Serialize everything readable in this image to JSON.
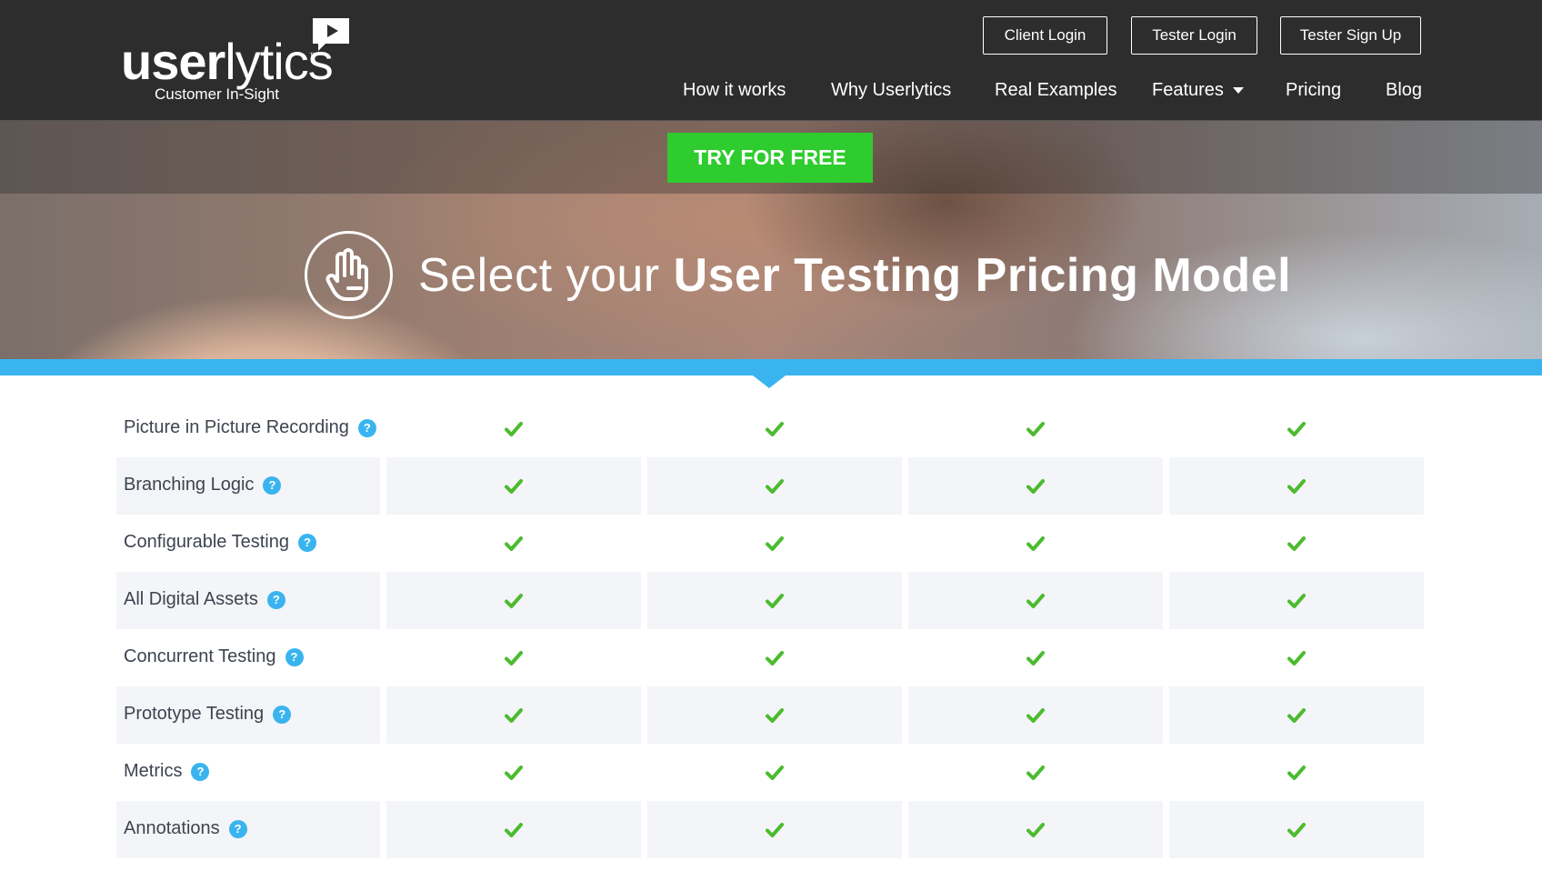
{
  "header": {
    "logo": {
      "word_bold": "user",
      "word_light": "lytics",
      "trademark": "™",
      "tagline": "Customer In-Sight"
    },
    "auth_buttons": {
      "client_login": "Client Login",
      "tester_login": "Tester Login",
      "tester_signup": "Tester Sign Up"
    },
    "nav": {
      "how_it_works": "How it works",
      "why_userlytics": "Why Userlytics",
      "real_examples": "Real Examples",
      "features": "Features",
      "pricing": "Pricing",
      "blog": "Blog"
    }
  },
  "hero": {
    "cta": "TRY FOR FREE",
    "title_light": "Select your ",
    "title_bold": "User Testing Pricing Model"
  },
  "colors": {
    "accent_blue": "#3ab4ef",
    "cta_green": "#2ecc2e",
    "check_green": "#4cbb2f",
    "header_bg": "#2d2d2d"
  },
  "table": {
    "help_glyph": "?",
    "features": [
      {
        "label": "Picture in Picture Recording",
        "checks": [
          true,
          true,
          true,
          true
        ]
      },
      {
        "label": "Branching Logic",
        "checks": [
          true,
          true,
          true,
          true
        ]
      },
      {
        "label": "Configurable Testing",
        "checks": [
          true,
          true,
          true,
          true
        ]
      },
      {
        "label": "All Digital Assets",
        "checks": [
          true,
          true,
          true,
          true
        ]
      },
      {
        "label": "Concurrent Testing",
        "checks": [
          true,
          true,
          true,
          true
        ]
      },
      {
        "label": "Prototype Testing",
        "checks": [
          true,
          true,
          true,
          true
        ]
      },
      {
        "label": "Metrics",
        "checks": [
          true,
          true,
          true,
          true
        ]
      },
      {
        "label": "Annotations",
        "checks": [
          true,
          true,
          true,
          true
        ]
      }
    ]
  }
}
